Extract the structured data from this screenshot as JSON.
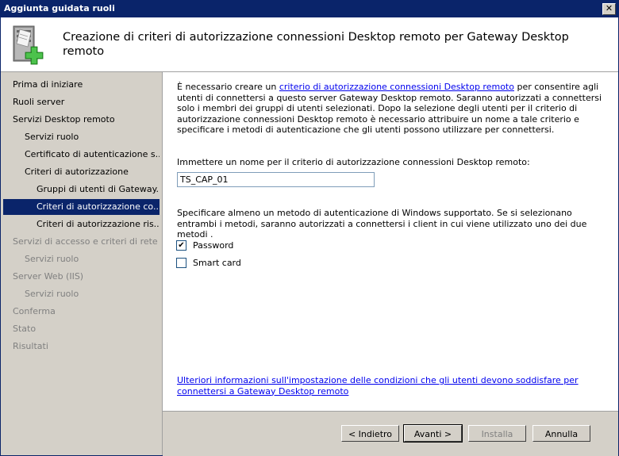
{
  "window": {
    "title": "Aggiunta guidata ruoli",
    "close_glyph": "✕"
  },
  "header": {
    "title": "Creazione di criteri di autorizzazione connessioni Desktop remoto per Gateway Desktop remoto",
    "icon": "server-add-role-icon"
  },
  "sidebar": {
    "items": [
      {
        "label": "Prima di iniziare"
      },
      {
        "label": "Ruoli server"
      },
      {
        "label": "Servizi Desktop remoto"
      },
      {
        "label": "Servizi ruolo"
      },
      {
        "label": "Certificato di autenticazione s..."
      },
      {
        "label": "Criteri di autorizzazione"
      },
      {
        "label": "Gruppi di utenti di Gateway..."
      },
      {
        "label": "Criteri di autorizzazione co..."
      },
      {
        "label": "Criteri di autorizzazione ris..."
      },
      {
        "label": "Servizi di accesso e criteri di rete"
      },
      {
        "label": "Servizi ruolo"
      },
      {
        "label": "Server Web (IIS)"
      },
      {
        "label": "Servizi ruolo"
      },
      {
        "label": "Conferma"
      },
      {
        "label": "Stato"
      },
      {
        "label": "Risultati"
      }
    ]
  },
  "content": {
    "desc_pre": "È necessario creare un ",
    "desc_link": "criterio di autorizzazione connessioni Desktop remoto",
    "desc_post": " per consentire agli utenti di connettersi a questo server Gateway Desktop remoto. Saranno autorizzati a connettersi solo i membri dei gruppi di utenti selezionati. Dopo la selezione degli utenti per il criterio di autorizzazione connessioni Desktop remoto è necessario attribuire un nome a tale criterio e specificare i metodi di autenticazione che gli utenti possono utilizzare per connettersi.",
    "name_label": "Immettere un nome per il criterio di autorizzazione connessioni Desktop remoto:",
    "name_value": "TS_CAP_01",
    "auth_desc": "Specificare almeno un metodo di autenticazione di Windows supportato. Se si selezionano entrambi i metodi, saranno autorizzati a connettersi i client in cui viene utilizzato uno dei due metodi .",
    "password_label": "Password",
    "password_checked": true,
    "smartcard_label": "Smart card",
    "smartcard_checked": false,
    "more_info": "Ulteriori informazioni sull'impostazione delle condizioni che gli utenti devono soddisfare per connettersi a Gateway Desktop remoto"
  },
  "footer": {
    "back": "< Indietro",
    "next": "Avanti >",
    "install": "Installa",
    "cancel": "Annulla"
  }
}
